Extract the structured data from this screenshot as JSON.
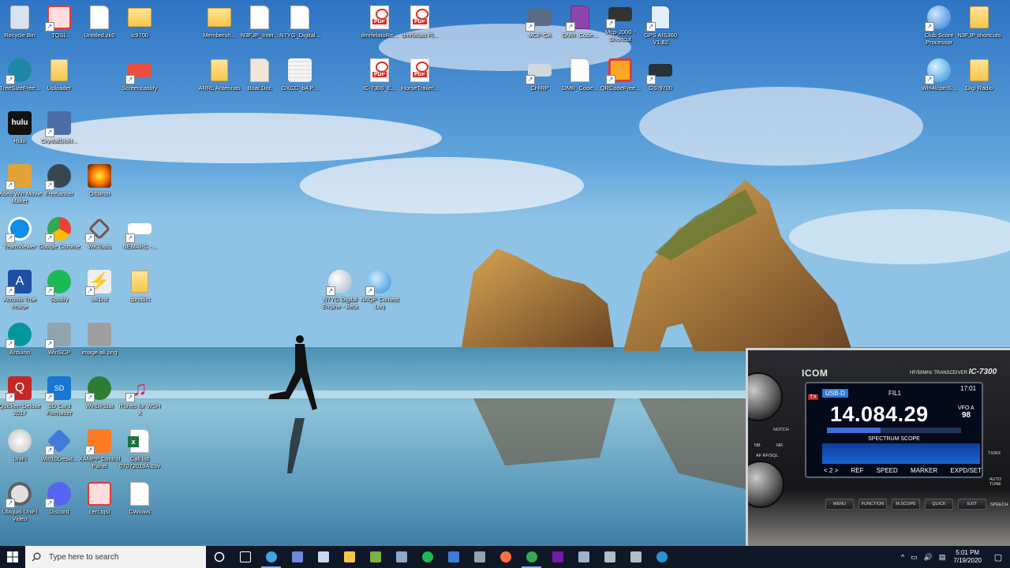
{
  "desktop_icons": [
    {
      "label": "Recycle Bin",
      "glyph": "recycle-bin-icon",
      "color": "#c9d6e3"
    },
    {
      "label": "TQSL",
      "glyph": "tqsl-icon",
      "color": "#e53935"
    },
    {
      "label": "Untitled.zk0",
      "glyph": "document-icon",
      "color": "#ffffff"
    },
    {
      "label": "ic9700",
      "glyph": "folder-icon",
      "color": "#f6c64b"
    },
    {
      "label": "Membersh...",
      "glyph": "folder-icon",
      "color": "#f6c64b"
    },
    {
      "label": "N3FJP_Inter...",
      "glyph": "document-icon",
      "color": "#ffffff"
    },
    {
      "label": "N7YG_Digital...",
      "glyph": "document-icon",
      "color": "#ffffff"
    },
    {
      "label": "dmrfelatoRe...",
      "glyph": "pdf-icon",
      "color": "#d93025"
    },
    {
      "label": "dmrfelato Fl...",
      "glyph": "pdf-icon",
      "color": "#d93025"
    },
    {
      "label": "MCP-CA",
      "glyph": "mcp-icon",
      "color": "#5b6b86"
    },
    {
      "label": "DMR_Code...",
      "glyph": "dmr-code-icon",
      "color": "#8e44ad"
    },
    {
      "label": "Mcp-2000 - Shortcut",
      "glyph": "kenwood-icon",
      "color": "#333333"
    },
    {
      "label": "GPS AIS360 V1.82",
      "glyph": "gps-icon",
      "color": "#1565c0"
    },
    {
      "label": "Club Score Processor",
      "glyph": "club-score-icon",
      "color": "#2b7bd0"
    },
    {
      "label": "N3FJP shortcuts",
      "glyph": "folder-icon",
      "color": "#f6c64b"
    },
    {
      "label": "TreeSizeFree...",
      "glyph": "treesize-icon",
      "color": "#1e88a8"
    },
    {
      "label": "Uploader",
      "glyph": "folder-icon",
      "color": "#f6c64b"
    },
    {
      "label": "Screencastify",
      "glyph": "screencastify-icon",
      "color": "#e94e3c"
    },
    {
      "label": "ARRL Antennas",
      "glyph": "folder-icon",
      "color": "#f6c64b"
    },
    {
      "label": "Boat Doc",
      "glyph": "boat-doc-icon",
      "color": "#6d4c41"
    },
    {
      "label": "DXCC_b4.P...",
      "glyph": "spreadsheet-icon",
      "color": "#e8e8e8"
    },
    {
      "label": "IC-7300_E...",
      "glyph": "pdf-icon",
      "color": "#d93025"
    },
    {
      "label": "HorseTrailer...",
      "glyph": "pdf-icon",
      "color": "#d93025"
    },
    {
      "label": "CHIRP",
      "glyph": "chirp-icon",
      "color": "#607d8b"
    },
    {
      "label": "DMR_Code...",
      "glyph": "document-gear-icon",
      "color": "#ffffff"
    },
    {
      "label": "QRCodeFree...",
      "glyph": "qrcode-icon",
      "color": "#e53935"
    },
    {
      "label": "GS-9700",
      "glyph": "gs9700-icon",
      "color": "#263238"
    },
    {
      "label": "Win4IcomS...",
      "glyph": "win4icom-icon",
      "color": "#2b8fd6"
    },
    {
      "label": "Digi Radio",
      "glyph": "folder-icon",
      "color": "#f6c64b"
    },
    {
      "label": "Hulu",
      "glyph": "hulu-icon",
      "color": "#111111"
    },
    {
      "label": "CrystalDiskI...",
      "glyph": "crystaldisk-icon",
      "color": "#4a6fa5"
    },
    {
      "label": "Video Win Movie Maker",
      "glyph": "movie-maker-icon",
      "color": "#3f51b5"
    },
    {
      "label": "Freelancer",
      "glyph": "freelancer-icon",
      "color": "#37474f"
    },
    {
      "label": "Orbitron",
      "glyph": "orbitron-icon",
      "color": "#ff6f00"
    },
    {
      "label": "TeamViewer",
      "glyph": "teamviewer-icon",
      "color": "#0e8ee9"
    },
    {
      "label": "Google Chrome",
      "glyph": "chrome-icon",
      "color": "#34a853"
    },
    {
      "label": "WKTools",
      "glyph": "wktools-icon",
      "color": "#795548"
    },
    {
      "label": "NEMARC -...",
      "glyph": "nemarc-icon",
      "color": "#ffffff"
    },
    {
      "label": "Acronis True Image",
      "glyph": "acronis-icon",
      "color": "#1e4fa3"
    },
    {
      "label": "Spotify",
      "glyph": "spotify-icon",
      "color": "#1db954"
    },
    {
      "label": "wk1rst",
      "glyph": "lightning-icon",
      "color": "#d32f2f"
    },
    {
      "label": "qprodict",
      "glyph": "folder-icon",
      "color": "#f6c64b"
    },
    {
      "label": "N7YG Digital Engine - Beta",
      "glyph": "engine-icon",
      "color": "#9fb3c8"
    },
    {
      "label": "NAQP Contest Log",
      "glyph": "globe-icon",
      "color": "#2b8fd6"
    },
    {
      "label": "Arduino",
      "glyph": "arduino-icon",
      "color": "#00979d"
    },
    {
      "label": "WinSCP",
      "glyph": "winscp-icon",
      "color": "#2e7d32"
    },
    {
      "label": "image-all.png",
      "glyph": "image-icon",
      "color": "#7a7a7a"
    },
    {
      "label": "Quicken Deluxe 2017",
      "glyph": "quicken-icon",
      "color": "#c62828"
    },
    {
      "label": "SD Card Formatter",
      "glyph": "sdcard-icon",
      "color": "#1976d2"
    },
    {
      "label": "WinDirStat",
      "glyph": "tree-icon",
      "color": "#2e7d32"
    },
    {
      "label": "iTunes for WSH X",
      "glyph": "music-icon",
      "color": "#e91e63"
    },
    {
      "label": "UniFi",
      "glyph": "unifi-icon",
      "color": "#e0e0e0"
    },
    {
      "label": "Win10Deskt...",
      "glyph": "tools-icon",
      "color": "#3f7bd8"
    },
    {
      "label": "XAMPP Control Panel",
      "glyph": "xampp-icon",
      "color": "#fb7a24"
    },
    {
      "label": "Call list 07072019A.csv",
      "glyph": "excel-icon",
      "color": "#1e7145"
    },
    {
      "label": "Ubiquiti UniFi Video",
      "glyph": "unifi-video-icon",
      "color": "#9e9e9e"
    },
    {
      "label": "Discord",
      "glyph": "discord-icon",
      "color": "#5865f2"
    },
    {
      "label": "cert.tqsl",
      "glyph": "tqsl-icon",
      "color": "#e53935"
    },
    {
      "label": "CWiows",
      "glyph": "document-icon",
      "color": "#ffffff"
    }
  ],
  "radio": {
    "brand": "ICOM",
    "model_small": "HF/50MHz TRANSCEIVER",
    "model": "IC-7300",
    "tx": "TX",
    "mode": "USB-D",
    "filter": "FIL1",
    "time": "17:01",
    "frequency": "14.084.29",
    "vfo": "VFO A",
    "vfo_value": "98",
    "scope_title": "SPECTRUM SCOPE",
    "bottom_keys": [
      "< 2 >",
      "REF",
      "SPEED",
      "MARKER",
      "EXPD/SET"
    ],
    "front_buttons": [
      "MENU",
      "FUNCTION",
      "M.SCOPE",
      "QUICK",
      "EXIT"
    ],
    "side_labels": [
      "NOTCH",
      "NB",
      "NR",
      "AF RF/SQL",
      "TX/RX",
      "AUTO TUNE",
      "SPEECH"
    ]
  },
  "taskbar": {
    "search_placeholder": "Type here to search",
    "pinned": [
      {
        "name": "task-view-icon",
        "color": "#ffffff",
        "active": false
      },
      {
        "name": "edge-icon",
        "color": "#3ea6e0",
        "active": true
      },
      {
        "name": "discord-icon",
        "color": "#7289da",
        "active": false
      },
      {
        "name": "app-icon",
        "color": "#c8d7ee",
        "active": false
      },
      {
        "name": "file-explorer-icon",
        "color": "#f6c64b",
        "active": false
      },
      {
        "name": "notepad-icon",
        "color": "#7cb342",
        "active": false
      },
      {
        "name": "network-icon",
        "color": "#8fa8c8",
        "active": false
      },
      {
        "name": "spotify-icon",
        "color": "#1db954",
        "active": false
      },
      {
        "name": "remote-icon",
        "color": "#3f7bd8",
        "active": false
      },
      {
        "name": "device-icon",
        "color": "#90a4ae",
        "active": false
      },
      {
        "name": "firefox-icon",
        "color": "#ff7139",
        "active": false
      },
      {
        "name": "chrome-icon",
        "color": "#34a853",
        "active": true
      },
      {
        "name": "onenote-icon",
        "color": "#7719aa",
        "active": false
      },
      {
        "name": "settings-icon",
        "color": "#9fb3c8",
        "active": false
      },
      {
        "name": "radio-app-icon",
        "color": "#b0bec5",
        "active": false
      },
      {
        "name": "printer-icon",
        "color": "#b0bec5",
        "active": false
      },
      {
        "name": "globe-icon",
        "color": "#2b8fd6",
        "active": false
      }
    ],
    "tray_icons": [
      "^",
      "▭",
      "🔊",
      "▤"
    ],
    "time": "5:01 PM",
    "date": "7/19/2020",
    "notification": "▢"
  }
}
